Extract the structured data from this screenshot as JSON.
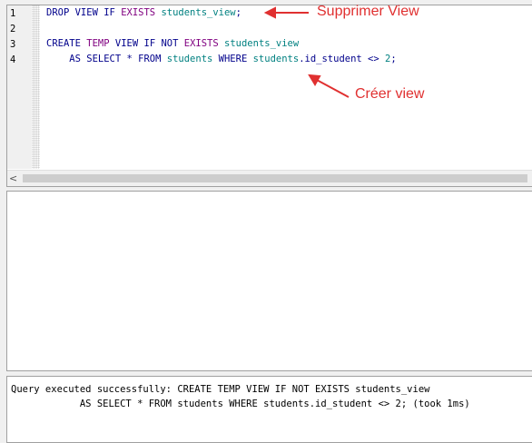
{
  "editor": {
    "line_numbers": [
      "1",
      "2",
      "3",
      "4"
    ],
    "lines": [
      [
        {
          "t": "DROP VIEW IF ",
          "c": "kw"
        },
        {
          "t": "EXISTS",
          "c": "pk"
        },
        {
          "t": " students_view",
          "c": "tb"
        },
        {
          "t": ";",
          "c": "kw"
        }
      ],
      [],
      [
        {
          "t": "CREATE ",
          "c": "kw"
        },
        {
          "t": "TEMP",
          "c": "pk"
        },
        {
          "t": " VIEW IF NOT ",
          "c": "kw"
        },
        {
          "t": "EXISTS",
          "c": "pk"
        },
        {
          "t": " students_view",
          "c": "tb"
        }
      ],
      [
        {
          "t": "    AS SELECT * FROM ",
          "c": "kw"
        },
        {
          "t": "students",
          "c": "tb"
        },
        {
          "t": " WHERE ",
          "c": "kw"
        },
        {
          "t": "students",
          "c": "tb"
        },
        {
          "t": ".id_student <> ",
          "c": "kw"
        },
        {
          "t": "2",
          "c": "nm"
        },
        {
          "t": ";",
          "c": "kw"
        }
      ]
    ],
    "scroll_left_glyph": "<"
  },
  "message": {
    "line1": "Query executed successfully: CREATE TEMP VIEW IF NOT EXISTS students_view",
    "line2": "            AS SELECT * FROM students WHERE students.id_student <> 2; (took 1ms)"
  },
  "annotations": {
    "drop": "Supprimer View",
    "create": "Créer view",
    "color": "#e03030"
  }
}
